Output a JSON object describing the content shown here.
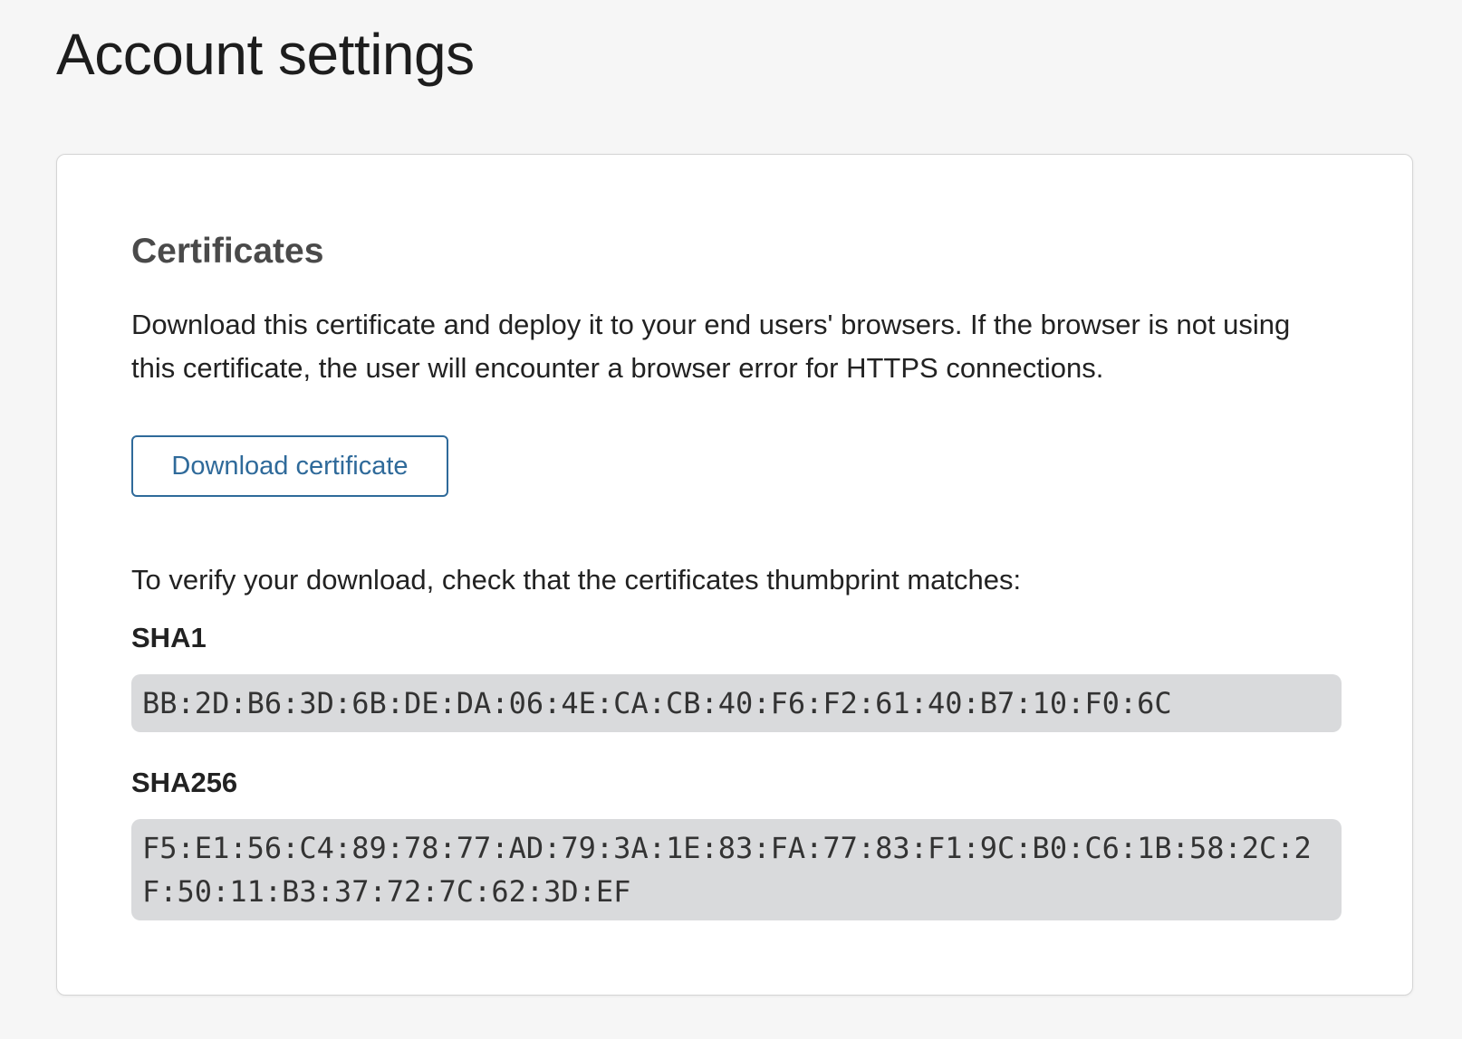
{
  "page": {
    "title": "Account settings"
  },
  "certificates": {
    "title": "Certificates",
    "description": "Download this certificate and deploy it to your end users' browsers. If the browser is not using this certificate, the user will encounter a browser error for HTTPS connections.",
    "download_label": "Download certificate",
    "verify_text": "To verify your download, check that the certificates thumbprint matches:",
    "sha1_label": "SHA1",
    "sha1_value": "BB:2D:B6:3D:6B:DE:DA:06:4E:CA:CB:40:F6:F2:61:40:B7:10:F0:6C",
    "sha256_label": "SHA256",
    "sha256_value": "F5:E1:56:C4:89:78:77:AD:79:3A:1E:83:FA:77:83:F1:9C:B0:C6:1B:58:2C:2F:50:11:B3:37:72:7C:62:3D:EF"
  },
  "colors": {
    "page_background": "#f6f6f6",
    "card_background": "#ffffff",
    "accent": "#2f6a9a",
    "hash_background": "#d9dadc"
  }
}
